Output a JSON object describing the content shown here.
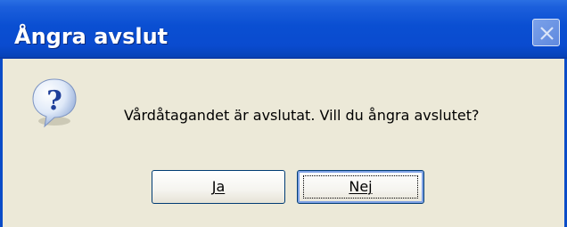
{
  "dialog": {
    "title": "Ångra avslut",
    "message": "Vårdåtagandet är avslutat. Vill du ångra avslutet?",
    "icon": "question-icon",
    "buttons": {
      "yes_label": "Ja",
      "no_label": "Nej"
    },
    "colors": {
      "titlebar": "#0a4fd2",
      "body": "#ece9d8",
      "button_border": "#003c74"
    }
  }
}
